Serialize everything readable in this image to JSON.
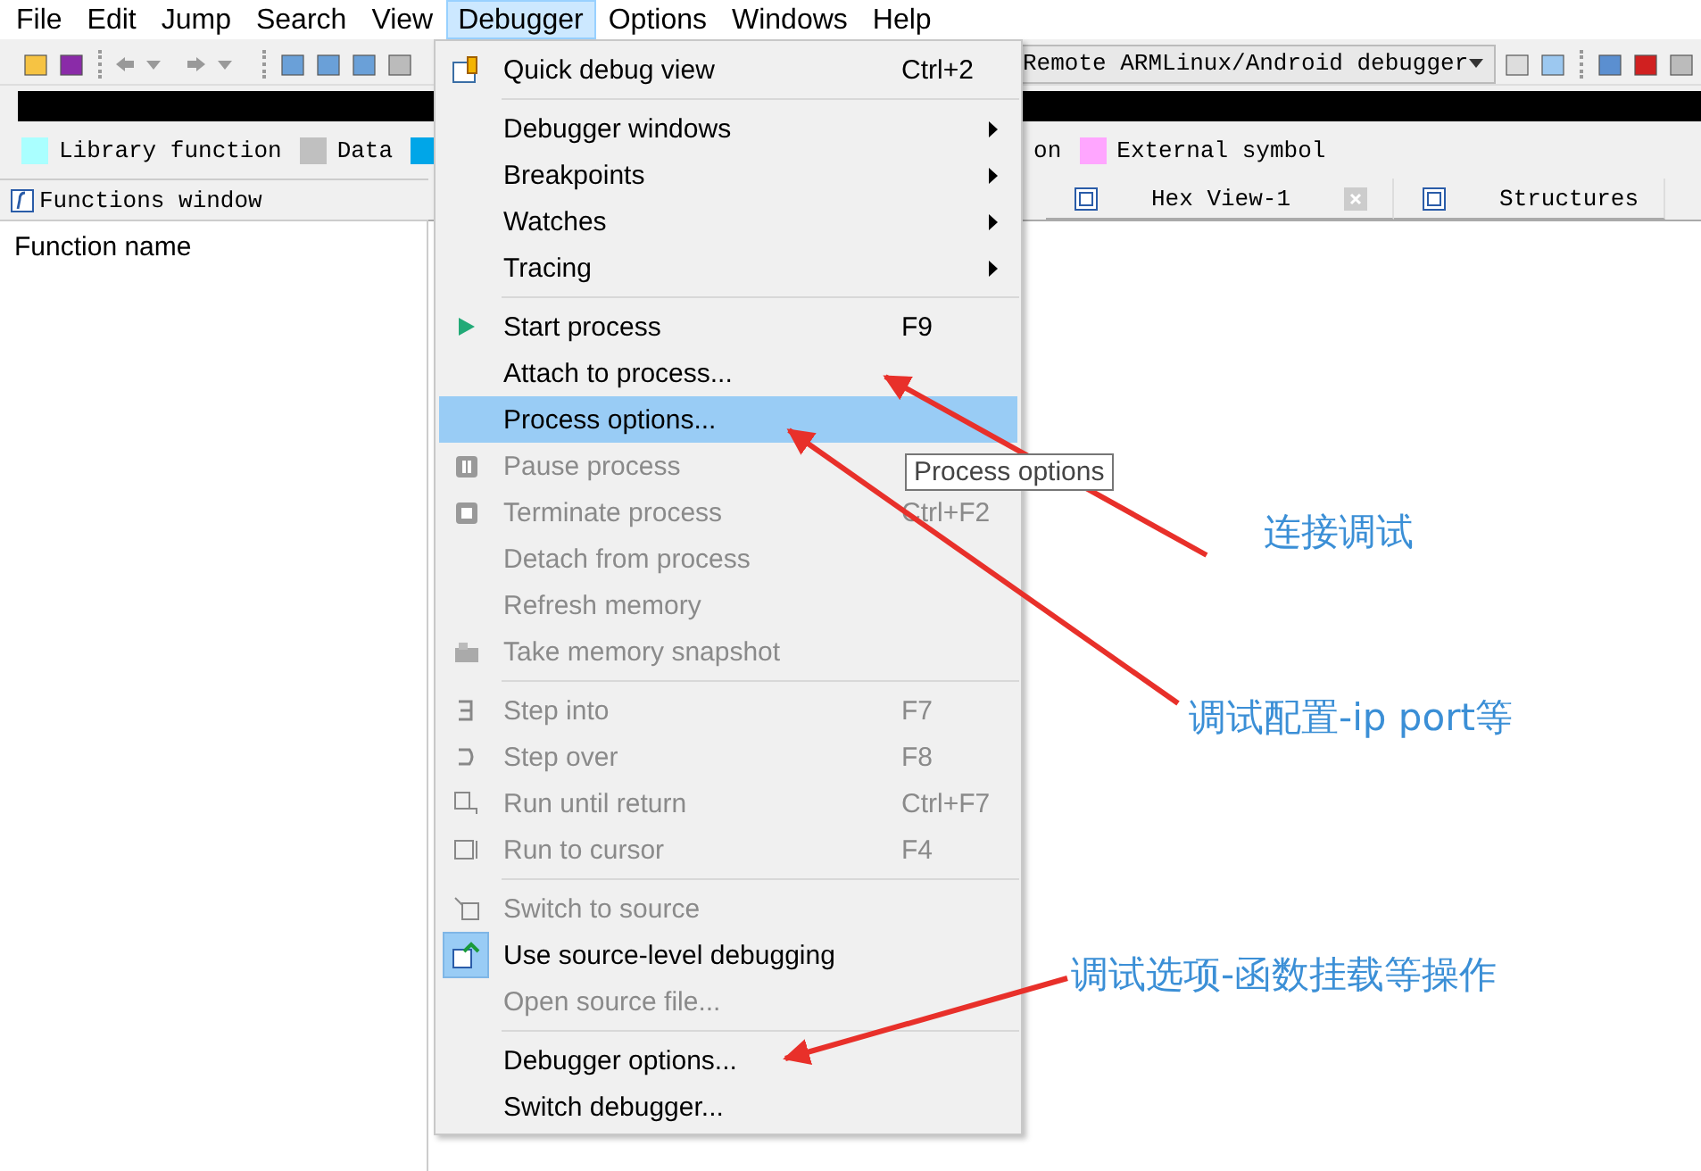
{
  "menubar": [
    {
      "label": "File",
      "selected": false
    },
    {
      "label": "Edit",
      "selected": false
    },
    {
      "label": "Jump",
      "selected": false
    },
    {
      "label": "Search",
      "selected": false
    },
    {
      "label": "View",
      "selected": false
    },
    {
      "label": "Debugger",
      "selected": true
    },
    {
      "label": "Options",
      "selected": false
    },
    {
      "label": "Windows",
      "selected": false
    },
    {
      "label": "Help",
      "selected": false
    }
  ],
  "toolbar": {
    "debugger_select": {
      "value": "Remote ARMLinux/Android debugger"
    }
  },
  "legend": [
    {
      "label": "Library function",
      "color": "#aaffff"
    },
    {
      "label": "Data",
      "color": "#c0c0c0"
    },
    {
      "color": "#00a6e8"
    },
    {
      "label": "on"
    },
    {
      "label": "External symbol",
      "color": "#ffa6ff"
    }
  ],
  "left_tab": {
    "label": "Functions window"
  },
  "right_tabs": [
    {
      "label": "Hex View-1",
      "selected": false
    },
    {
      "label": "Structures",
      "selected": false
    }
  ],
  "functions_window": {
    "column": "Function name"
  },
  "debugger_menu": [
    {
      "kind": "item",
      "label": "Quick debug view",
      "shortcut": "Ctrl+2",
      "submenu": false,
      "disabled": false,
      "selected": false,
      "checked": false
    },
    {
      "kind": "separator"
    },
    {
      "kind": "item",
      "label": "Debugger windows",
      "submenu": true,
      "disabled": false,
      "selected": false,
      "checked": false
    },
    {
      "kind": "item",
      "label": "Breakpoints",
      "submenu": true,
      "disabled": false,
      "selected": false,
      "checked": false
    },
    {
      "kind": "item",
      "label": "Watches",
      "submenu": true,
      "disabled": false,
      "selected": false,
      "checked": false
    },
    {
      "kind": "item",
      "label": "Tracing",
      "submenu": true,
      "disabled": false,
      "selected": false,
      "checked": false
    },
    {
      "kind": "separator"
    },
    {
      "kind": "item",
      "label": "Start process",
      "shortcut": "F9",
      "submenu": false,
      "disabled": false,
      "selected": false,
      "checked": false
    },
    {
      "kind": "item",
      "label": "Attach to process...",
      "submenu": false,
      "disabled": false,
      "selected": false,
      "checked": false
    },
    {
      "kind": "item",
      "label": "Process options...",
      "submenu": false,
      "disabled": false,
      "selected": true,
      "checked": false
    },
    {
      "kind": "item",
      "label": "Pause process",
      "submenu": false,
      "disabled": true,
      "selected": false,
      "checked": false
    },
    {
      "kind": "item",
      "label": "Terminate process",
      "shortcut": "Ctrl+F2",
      "submenu": false,
      "disabled": true,
      "selected": false,
      "checked": false
    },
    {
      "kind": "item",
      "label": "Detach from process",
      "submenu": false,
      "disabled": true,
      "selected": false,
      "checked": false
    },
    {
      "kind": "item",
      "label": "Refresh memory",
      "submenu": false,
      "disabled": true,
      "selected": false,
      "checked": false
    },
    {
      "kind": "item",
      "label": "Take memory snapshot",
      "submenu": false,
      "disabled": true,
      "selected": false,
      "checked": false
    },
    {
      "kind": "separator"
    },
    {
      "kind": "item",
      "label": "Step into",
      "shortcut": "F7",
      "submenu": false,
      "disabled": true,
      "selected": false,
      "checked": false
    },
    {
      "kind": "item",
      "label": "Step over",
      "shortcut": "F8",
      "submenu": false,
      "disabled": true,
      "selected": false,
      "checked": false
    },
    {
      "kind": "item",
      "label": "Run until return",
      "shortcut": "Ctrl+F7",
      "submenu": false,
      "disabled": true,
      "selected": false,
      "checked": false
    },
    {
      "kind": "item",
      "label": "Run to cursor",
      "shortcut": "F4",
      "submenu": false,
      "disabled": true,
      "selected": false,
      "checked": false
    },
    {
      "kind": "separator"
    },
    {
      "kind": "item",
      "label": "Switch to source",
      "submenu": false,
      "disabled": true,
      "selected": false,
      "checked": false
    },
    {
      "kind": "item",
      "label": "Use source-level debugging",
      "submenu": false,
      "disabled": false,
      "selected": false,
      "checked": true
    },
    {
      "kind": "item",
      "label": "Open source file...",
      "submenu": false,
      "disabled": true,
      "selected": false,
      "checked": false
    },
    {
      "kind": "separator"
    },
    {
      "kind": "item",
      "label": "Debugger options...",
      "submenu": false,
      "disabled": false,
      "selected": false,
      "checked": false
    },
    {
      "kind": "item",
      "label": "Switch debugger...",
      "submenu": false,
      "disabled": false,
      "selected": false,
      "checked": false
    }
  ],
  "tooltip": {
    "text": "Process options"
  },
  "annotations": [
    {
      "text": "连接调试"
    },
    {
      "text": "调试配置-ip port等"
    },
    {
      "text": "调试选项-函数挂载等操作"
    }
  ]
}
